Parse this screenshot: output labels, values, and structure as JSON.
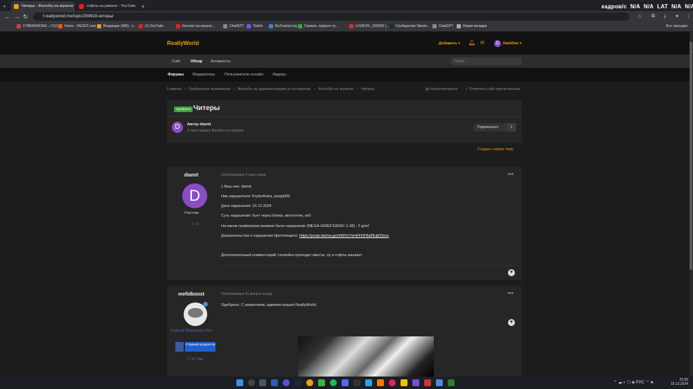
{
  "browser": {
    "tabs": [
      {
        "label": "Читеры - Жалобы на игроков",
        "color": "#f0a000"
      },
      {
        "label": "софты на ривали - YouTube",
        "color": "#e62117"
      }
    ],
    "url": "f.reallyworld.me/topic/294918-читеры/",
    "fps_label": "кадров/с",
    "fps_values": [
      "N/A",
      "N/A",
      "LAT",
      "N/A",
      "N/A"
    ],
    "bookmarks": [
      {
        "label": "CYBERSHOKE – CS2...",
        "color": "#d04040"
      },
      {
        "label": "Home - FACEIT.com",
        "color": "#ff5500"
      },
      {
        "label": "Входящие (586) - z...",
        "color": "#e0a020"
      },
      {
        "label": "(1) YouTube",
        "color": "#e62117"
      },
      {
        "label": "Контакт на канале...",
        "color": "#e62117"
      },
      {
        "label": "ChatGPT",
        "color": "#888888"
      },
      {
        "label": "Twitch",
        "color": "#9146ff"
      },
      {
        "label": "RuTracker.org",
        "color": "#4a7fd0"
      },
      {
        "label": "Скачать торрент-ту...",
        "color": "#3ca43c"
      },
      {
        "label": "UrSNVPL_250050 |...",
        "color": "#cc3333"
      },
      {
        "label": "Сообщество Steam...",
        "color": "#1b2838"
      },
      {
        "label": "ChatGPT",
        "color": "#888888"
      },
      {
        "label": "Новая вкладка",
        "color": "#aaaaaa"
      }
    ],
    "all_bookmarks": "Все закладки"
  },
  "site": {
    "logo": "ReallyWorld",
    "add": "Добавить ▾",
    "user": "DarkDas ▾",
    "user_initial": "D",
    "nav1": [
      {
        "label": "Сайт"
      },
      {
        "label": "Обзор"
      },
      {
        "label": "Активность"
      }
    ],
    "search_placeholder": "Поиск...",
    "nav2": [
      {
        "label": "Форумы"
      },
      {
        "label": "Модераторы"
      },
      {
        "label": "Пользователи онлайн"
      },
      {
        "label": "Лидеры"
      }
    ],
    "breadcrumbs": [
      "Главная",
      "›",
      "Гриферское выживание",
      "›",
      "Жалобы на администрацию и на игроков.",
      "›",
      "Жалобы на игроков.",
      "›",
      "Читеры"
    ],
    "unread": "Непрочитанное",
    "mark_read": "Отметить сайт прочитанным"
  },
  "topic": {
    "badge": "Одобрено",
    "title": "Читеры",
    "author_initial": "D",
    "author": "Автор diamit",
    "meta": "3 часа назад в Жалобы на игроков.",
    "subscribe": "Подписаться",
    "subscribe_count": "1",
    "new_topic": "Создать новую тему"
  },
  "posts": [
    {
      "name": "diamit",
      "initial": "D",
      "role": "Участник",
      "rep": "3",
      "date": "Опубликовано 3 часа назад",
      "lines": [
        "1.Ваш ник: diamit",
        "Ник нарушителя: KrytkoKiara, pinqq008",
        "Дата нарушения: 15.12.2024",
        "Суть нарушения: бьет через блоки, автототем, акб",
        "На каком гриферском режиме было нарушение (MEGA-GRIEF/GRIEF-1-38) : 5 grief"
      ],
      "proof_label": "Доказательства о нарушении (фото/видео):",
      "proof_link": "https://youtu.be/rss.jpchN3Vs?si=EFDF8a0fUpD2zzz",
      "comment": "Дополнительный комментарий: спокойно проходит квесты, ну а софты мешают"
    },
    {
      "name": "mefidboost",
      "role": "Старший Модератор (Gar)",
      "group_tag": "Старший модератор",
      "rep": "3,7 тыс",
      "date": "Опубликовано 41 минута назад",
      "text": "Одобрено. С уважением, администрация ReallyWorld."
    }
  ],
  "taskbar": {
    "lang": "РУС",
    "time": "22:55",
    "date": "15.12.2024"
  }
}
